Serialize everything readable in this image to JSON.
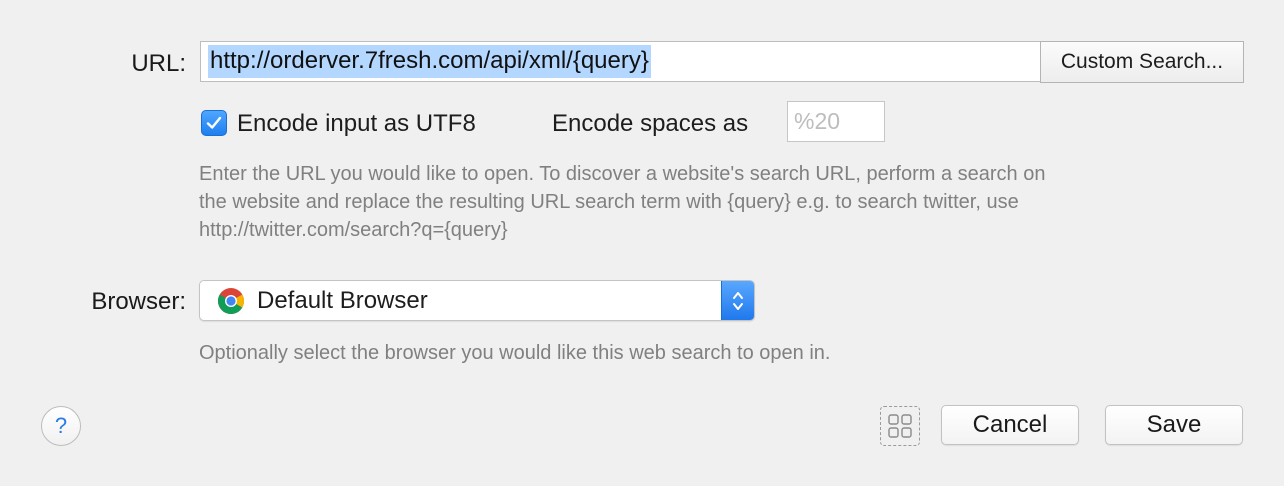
{
  "url_section": {
    "label": "URL:",
    "url_value": "http://orderver.7fresh.com/api/xml/{query}",
    "custom_search_label": "Custom Search...",
    "encode_utf8_label": "Encode input as UTF8",
    "encode_utf8_checked": true,
    "encode_spaces_label": "Encode spaces as",
    "encode_spaces_placeholder": "%20",
    "help_line1": "Enter the URL you would like to open. To discover a website's search URL, perform a search on",
    "help_line2": "the website and replace the resulting URL search term with {query} e.g. to search twitter, use",
    "help_line3": "http://twitter.com/search?q={query}"
  },
  "browser_section": {
    "label": "Browser:",
    "selected": "Default Browser",
    "icon": "chrome-icon",
    "help": "Optionally select the browser you would like this web search to open in."
  },
  "footer": {
    "help_symbol": "?",
    "cancel_label": "Cancel",
    "save_label": "Save"
  },
  "colors": {
    "accent": "#1f7ff0",
    "selection": "#b3d7ff",
    "help_text": "#808080",
    "background": "#f0f0f0"
  }
}
